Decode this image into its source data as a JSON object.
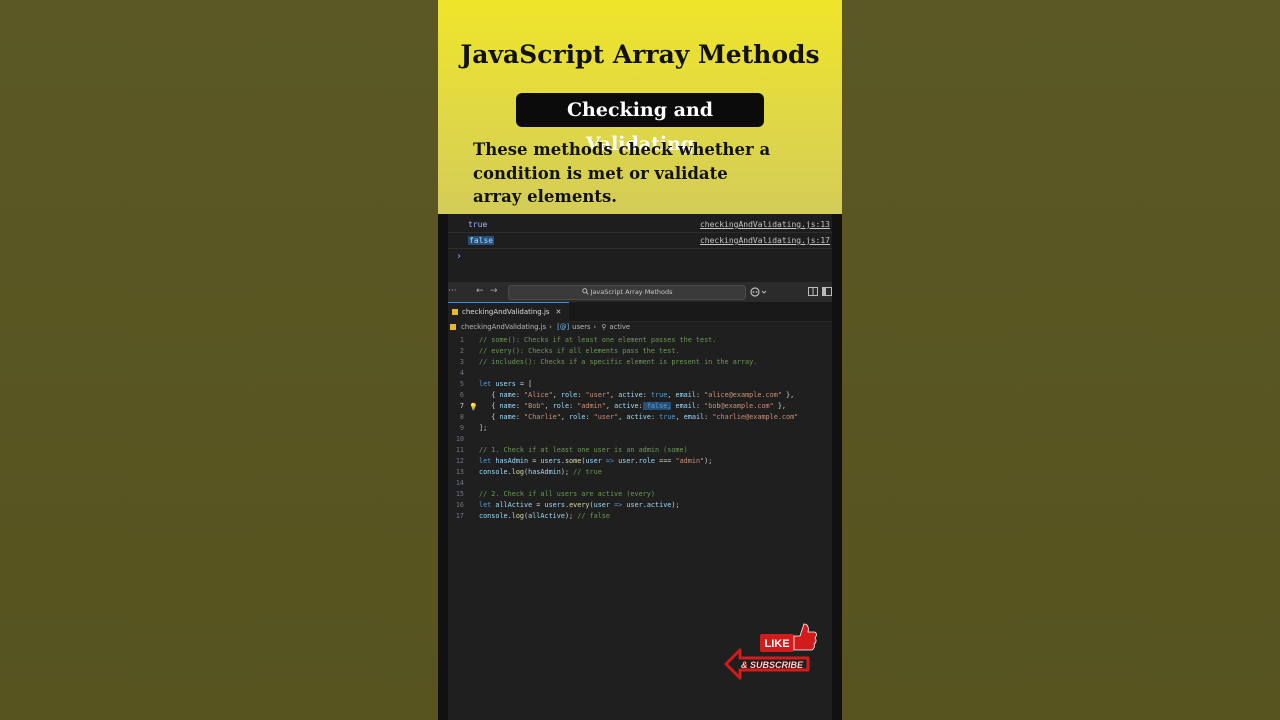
{
  "banner": {
    "title": "JavaScript Array Methods",
    "subtitle": "Checking and Validating",
    "description": "These methods check whether a condition is met or validate array elements."
  },
  "console": {
    "rows": [
      {
        "value": "true",
        "source": "checkingAndValidating.js:13"
      },
      {
        "value": "false",
        "source": "checkingAndValidating.js:17"
      }
    ],
    "prompt": "›"
  },
  "toolbar": {
    "search_text": "JavaScript Array Methods",
    "more": "···",
    "back": "←",
    "forward": "→",
    "search_icon": "search-icon",
    "copilot_icon": "copilot-icon"
  },
  "editor": {
    "tab_label": "checkingAndValidating.js",
    "tab_close": "✕",
    "breadcrumb": [
      "checkingAndValidating.js",
      "users",
      "active"
    ],
    "line_numbers": [
      "1",
      "2",
      "3",
      "4",
      "5",
      "6",
      "7",
      "8",
      "9",
      "10",
      "11",
      "12",
      "13",
      "14",
      "15",
      "16",
      "17"
    ],
    "current_line": "7"
  },
  "badge": {
    "like": "LIKE",
    "subscribe": "& SUBSCRIBE"
  },
  "colors": {
    "banner_yellow": "#efe52a",
    "background_olive": "#5a5624",
    "editor_bg": "#1f1f1f",
    "comment_green": "#6a9955",
    "string_orange": "#ce9178",
    "keyword_blue": "#569cd6",
    "badge_red": "#d21c1c"
  }
}
